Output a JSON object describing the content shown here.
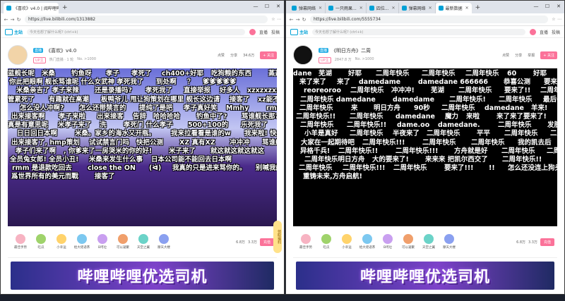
{
  "left": {
    "tabs": [
      {
        "label": "《喜欢》v4.0 | 阅哔哩哔...",
        "active": true
      },
      {
        "label": "",
        "active": false
      }
    ],
    "url": "https://live.bilibili.com/1313882",
    "search_placeholder": "今天也想了解什么呢? (ctrl+k)",
    "header_links": [
      "直播",
      "投稿"
    ],
    "room": {
      "badge": "直播",
      "title": "《喜欢》v4.0",
      "meta": [
        "UP主",
        "热门直播 · 1 轮",
        "No. >1000"
      ],
      "stats": [
        "点赞",
        "分享",
        "34.6万"
      ],
      "follow": "+ 关注"
    },
    "danmaku": [
      "蓝舰长呢",
      "米桑",
      "钓鱼呀",
      "孝子",
      "孝死了",
      "ch400+好耶",
      "吃狗粮的东西",
      "蒸蒸日常",
      "你此把眼啊 舰长骂谁呢 什么女武神 孝死我了",
      "到处啊",
      "？",
      "爹爹爹爹爹",
      "米桑亲吉了 孝子来辣",
      "还是录播吗?",
      "孝死我了",
      "直接举报",
      "好多人",
      "xzxzxzxzxz",
      "管累死了",
      "有趣就在高潮",
      "板鸭爷儿 甩让狗策划在哪里 舰长这边请",
      "接客了",
      "xz能不能go啊",
      "怎么没人冲啊?",
      "怎么还带禁言的",
      "提纯了是吧",
      "孝子真好笑",
      "Mmhy",
      "rmm 道歉",
      "出来接客啊",
      "孝子来啦",
      "出来接客",
      "告辞",
      "哈哈哈哈",
      "钓鱼中了?",
      "骂谁舰长那?",
      "真是有意思呢",
      "米孝子来了",
      "洗",
      "孝死门 什么孝子",
      "500+100的",
      "乐死我了",
      "走了",
      "日日回日本啊",
      "米桑。家乡的海水又开瓶。",
      "我来拉看看是谁的w",
      "我来啦! 快是边请",
      "出来接客了, hmp策划",
      "试试禁言门吗",
      "快把公测",
      "XZ 真有XZ",
      "冲冲冲",
      "骂谁舰长呢",
      "孝子们来了啊",
      ", 你爹来了一房哭米的你的好!",
      "米子来了",
      "就这就这就这就这",
      "全员兔女郎! 全员小丑!",
      "米桑来发生什么事",
      "日本公司能不能回去日本啊",
      "rmm 是退款吃回去",
      "close the ON",
      "(ᐛ)",
      "我真的只是进来骂你的。",
      "别喊我舰长,我",
      "爲世界所有的美元而戰",
      "接客了"
    ],
    "gifts": [
      "最佳手势",
      "吃瓜",
      "小幸运",
      "给大佬递茶",
      "B坷垃",
      "可以凝聚",
      "天空之翼",
      "摩天大楼"
    ],
    "wallet": [
      "6.8万",
      "3.3万"
    ],
    "topup": "充值",
    "side_button": "领取福利",
    "banner": "哔哩哔哩优选司机"
  },
  "right": {
    "tabs": [
      {
        "label": "弹幕网络",
        "active": false
      },
      {
        "label": "一只雨果...",
        "active": false
      },
      {
        "label": "四位...",
        "active": false
      },
      {
        "label": "弹幕网络",
        "active": false
      },
      {
        "label": "最新数据",
        "active": true
      }
    ],
    "url": "https://live.bilibili.com/5555734",
    "search_placeholder": "今天也想了解什么呢? (ctrl+k)",
    "header_links": [
      "直播",
      "投稿"
    ],
    "room": {
      "badge": "直播",
      "title": "《明日方舟》二周",
      "meta": [
        "UP主",
        "2847.8 万",
        "No. >1000"
      ],
      "stats": [
        "点赞",
        "分享",
        "举报"
      ],
      "follow": "+ 关注"
    },
    "danmaku": [
      "dane",
      "芜湖",
      "好耶",
      "二周年快乐",
      "二周年快乐",
      "二周年快乐",
      "60",
      "好耶",
      "好耶i",
      "来了来了",
      "来了",
      "damedame",
      "damedane 666666",
      "恭喜公测",
      "要来啦!",
      "reoreoroo",
      "二周年快乐",
      "冲冲冲!",
      "芜湖",
      "二周年快乐",
      "要来了!!",
      "二周年快乐",
      "二周年快乐 damedane",
      "damedame",
      "二周年快乐!",
      "二周年快乐",
      "最后60秒!",
      "二周年快乐",
      "来",
      "明日方舟",
      "90秒",
      "二周年快乐",
      "damedane",
      "羊来!",
      "二周年快乐!!",
      "二周年快乐",
      "damedane",
      "魔力",
      "来啦",
      "来了来了要来了!",
      "二周年快乐",
      "二周年快乐!!",
      "dame.oo",
      "damedane.",
      "二周年快乐",
      "发肤",
      "小羊是真好",
      "二周年快乐",
      "半夜来了",
      "二周年快乐",
      "平平",
      "二周年快乐",
      "二周年快乐",
      "大家在一起期待吧",
      "二周年快乐!!!",
      "二周年快乐",
      "二周年快乐",
      "我的凯去后",
      "异格千兵!",
      "二周年快乐!!",
      "二周年快乐!!!",
      "方舟就是好",
      "二周年快乐",
      "二周年快乐",
      "二周年快乐明日方舟",
      "大的要来了!",
      "来来来 把凯尔西交了",
      "二周年快乐!!",
      "二周年快乐",
      "二周年快乐!!!",
      "二周年快乐",
      "要来了!!!",
      "!!",
      "怎么还没连上狗头?",
      "重铸未来,方舟启航!"
    ],
    "gifts": [
      "最佳手势",
      "吃瓜",
      "小幸运",
      "给大佬递茶",
      "B坷垃",
      "可以凝聚",
      "天空之翼",
      "摩天大楼"
    ],
    "wallet": [
      "6.8万",
      "3.3万"
    ],
    "topup": "充值",
    "banner": "哔哩哔哩优选司机"
  },
  "colors": {
    "brand": "#00a1d6",
    "pink": "#fb7299",
    "danmaku": "#ffffff"
  },
  "icons": [
    "back-icon",
    "forward-icon",
    "refresh-icon",
    "close-icon",
    "minimize-icon",
    "maximize-icon"
  ]
}
